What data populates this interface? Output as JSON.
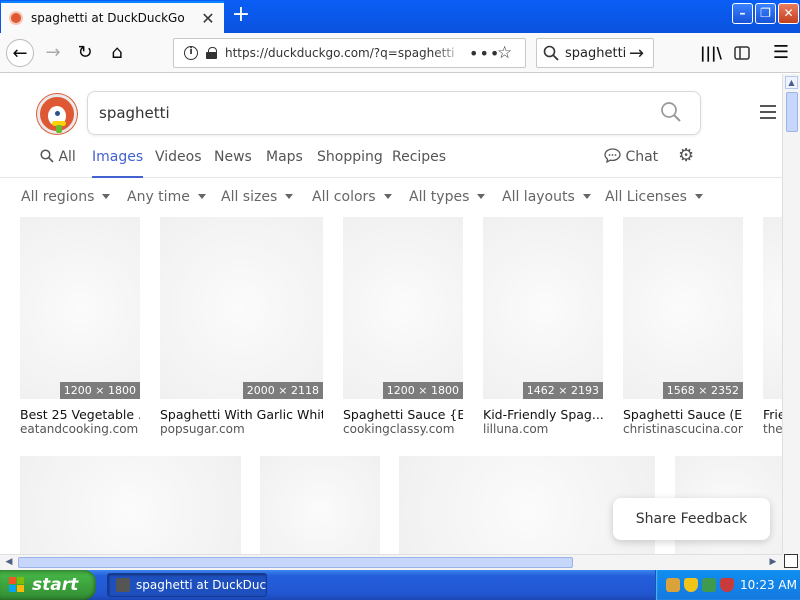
{
  "browser": {
    "tab_title": "spaghetti at DuckDuckGo",
    "url": "https://duckduckgo.com/?q=spaghetti",
    "search_box": "spaghetti"
  },
  "page": {
    "query": "spaghetti",
    "tabs": [
      "All",
      "Images",
      "Videos",
      "News",
      "Maps",
      "Shopping",
      "Recipes"
    ],
    "active_tab": "Images",
    "chat_label": "Chat",
    "filters": [
      "All regions",
      "Any time",
      "All sizes",
      "All colors",
      "All types",
      "All layouts",
      "All Licenses"
    ],
    "images": [
      {
        "dim": "1200 × 1800",
        "title": "Best 25 Vegetable ...",
        "source": "eatandcooking.com"
      },
      {
        "dim": "2000 × 2118",
        "title": "Spaghetti With Garlic Whit...",
        "source": "popsugar.com"
      },
      {
        "dim": "1200 × 1800",
        "title": "Spaghetti Sauce {E...",
        "source": "cookingclassy.com"
      },
      {
        "dim": "1462 × 2193",
        "title": "Kid-Friendly Spag...",
        "source": "lilluna.com"
      },
      {
        "dim": "1568 × 2352",
        "title": "Spaghetti Sauce (E...",
        "source": "christinascucina.com"
      },
      {
        "dim": "",
        "title": "Frie",
        "source": "thet"
      }
    ],
    "share_feedback": "Share Feedback"
  },
  "taskbar": {
    "start": "start",
    "task": "spaghetti at DuckDuc...",
    "clock": "10:23 AM"
  }
}
